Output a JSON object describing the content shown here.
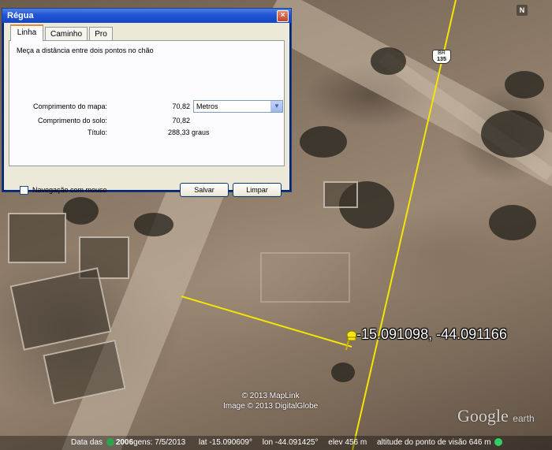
{
  "dialog": {
    "title": "Régua",
    "close_label": "×",
    "tabs": [
      {
        "label": "Linha",
        "active": true
      },
      {
        "label": "Caminho",
        "active": false
      },
      {
        "label": "Pro",
        "active": false
      }
    ],
    "instruction": "Meça a distância entre dois pontos no chão",
    "map_length_label": "Comprimento do mapa:",
    "map_length_value": "70,82",
    "units_selected": "Metros",
    "ground_length_label": "Comprimento do solo:",
    "ground_length_value": "70,82",
    "heading_label": "Título:",
    "heading_value": "288,33 graus",
    "mouse_nav_label": "Navegação com mouse",
    "mouse_nav_checked": false,
    "save_label": "Salvar",
    "clear_label": "Limpar"
  },
  "map": {
    "placemark_label": "-15.091098, -44.091166",
    "road_shield_top": "BR",
    "road_shield_number": "135",
    "compass_label": "N",
    "copyright_1": "© 2013 MapLink",
    "copyright_2": "Image © 2013 DigitalGlobe",
    "logo_text": "Google",
    "logo_suffix": "earth",
    "line_color": "#f5e600",
    "placemark_icon": "pushpin-icon"
  },
  "status": {
    "imagery_date_label": "Data das",
    "imagery_year": "2006",
    "imagery_date_text": "gens: 7/5/2013",
    "lat": "lat  -15.090609°",
    "lon": "lon  -44.091425°",
    "elev": "elev   456 m",
    "eye_alt": "altitude do ponto de visão    646 m"
  }
}
